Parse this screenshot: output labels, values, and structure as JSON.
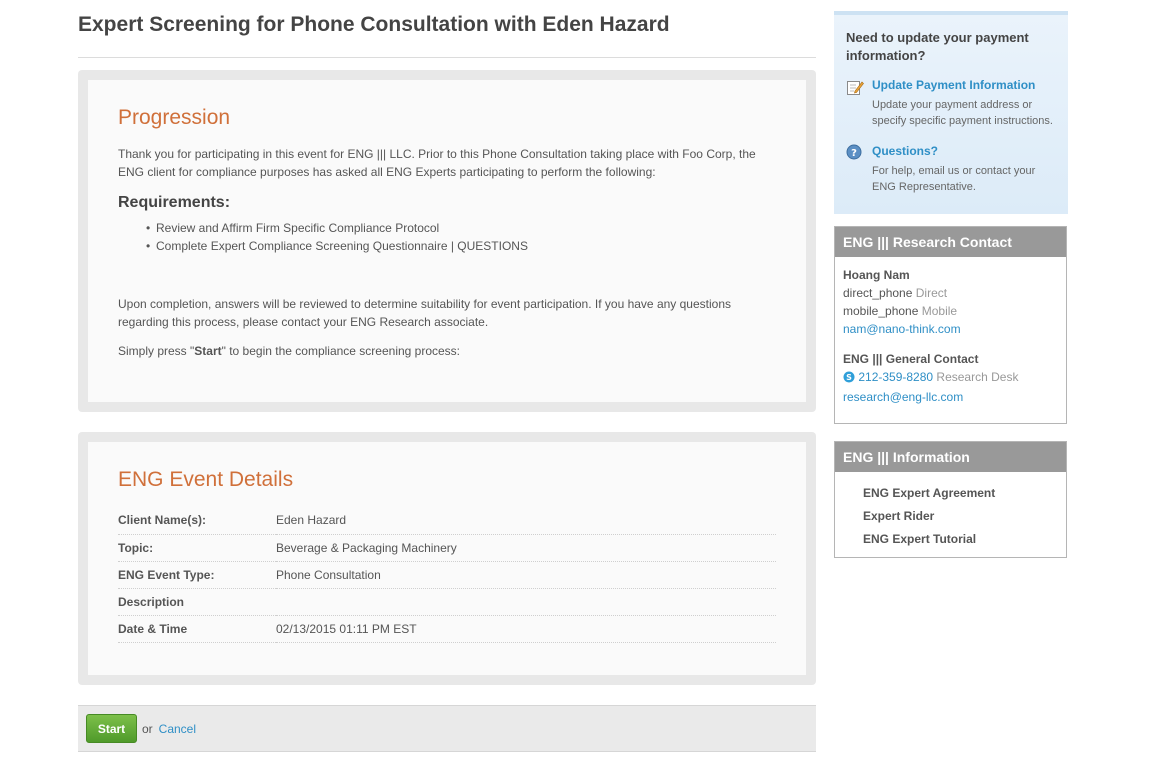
{
  "page": {
    "title": "Expert Screening for Phone Consultation with Eden Hazard"
  },
  "progression": {
    "heading": "Progression",
    "intro": "Thank you for participating in this event for ENG ||| LLC. Prior to this Phone Consultation taking place with Foo Corp, the ENG client for compliance purposes has asked all ENG Experts participating to perform the following:",
    "requirements_heading": "Requirements:",
    "requirements": [
      "Review and Affirm Firm Specific Compliance Protocol",
      "Complete Expert Compliance Screening Questionnaire | QUESTIONS"
    ],
    "completion": "Upon completion, answers will be reviewed to determine suitability for event participation. If you have any questions regarding this process, please contact your ENG Research associate.",
    "press_prefix": "Simply press \"",
    "press_keyword": "Start",
    "press_suffix": "\" to begin the compliance screening process:"
  },
  "event_details": {
    "heading": "ENG Event Details",
    "rows": [
      {
        "label": "Client Name(s):",
        "value": "Eden Hazard"
      },
      {
        "label": "Topic:",
        "value": "Beverage & Packaging Machinery"
      },
      {
        "label": "ENG Event Type:",
        "value": "Phone Consultation"
      },
      {
        "label": "Description",
        "value": ""
      },
      {
        "label": "Date & Time",
        "value": "02/13/2015 01:11 PM EST"
      }
    ]
  },
  "actions": {
    "start_label": "Start",
    "or_text": "or",
    "cancel_label": "Cancel"
  },
  "sidebar": {
    "payment": {
      "title": "Need to update your payment information?",
      "update_link": "Update Payment Information",
      "update_desc": "Update your payment address or specify specific payment instructions.",
      "questions_link": "Questions?",
      "questions_desc": "For help, email us or contact your ENG Representative."
    },
    "contact": {
      "heading": "ENG ||| Research Contact",
      "name": "Hoang Nam",
      "direct_phone": "direct_phone",
      "direct_label": "Direct",
      "mobile_phone": "mobile_phone",
      "mobile_label": "Mobile",
      "email": "nam@nano-think.com",
      "general_title": "ENG ||| General Contact",
      "general_phone": "212-359-8280",
      "general_phone_label": "Research Desk",
      "general_email": "research@eng-llc.com"
    },
    "information": {
      "heading": "ENG ||| Information",
      "items": [
        "ENG Expert Agreement",
        "Expert Rider",
        "ENG Expert Tutorial"
      ]
    }
  },
  "colors": {
    "accent_orange": "#d0703a",
    "link_blue": "#2f8fc6",
    "start_green": "#5fae34",
    "sidebar_header_gray": "#999999"
  }
}
